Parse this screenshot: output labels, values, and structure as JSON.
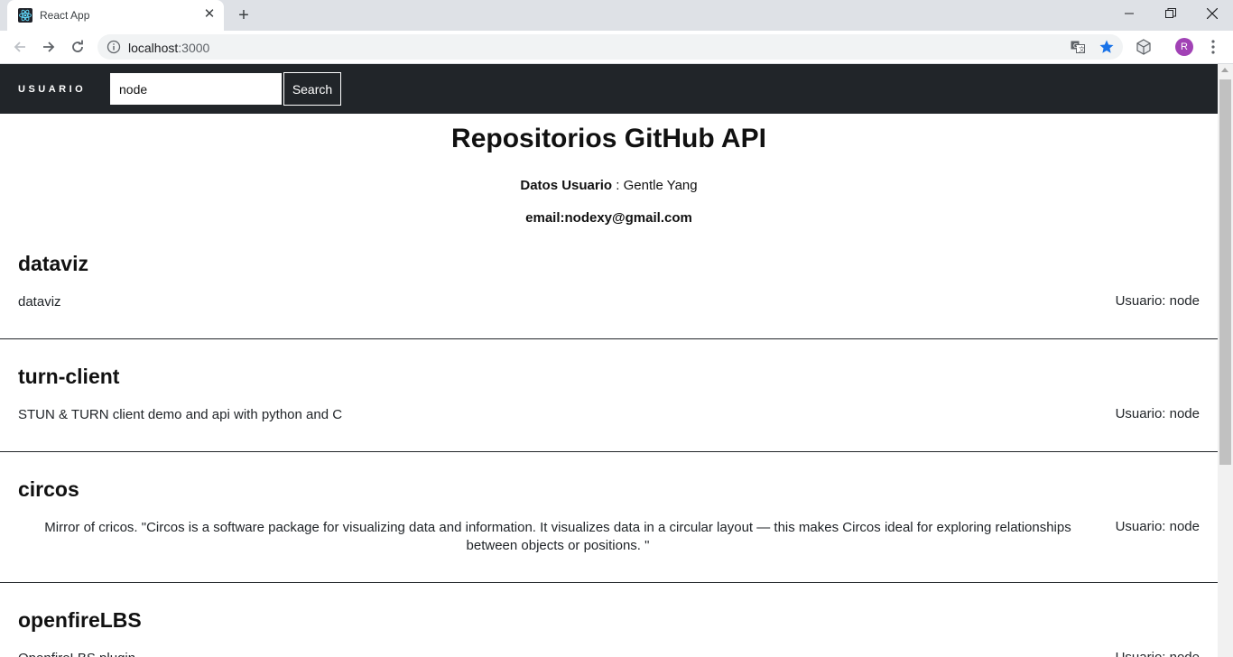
{
  "browser": {
    "tab_title": "React App",
    "url_host": "localhost",
    "url_port": ":3000"
  },
  "icons": {
    "favicon": "react-logo-icon",
    "close": "close-icon",
    "new_tab": "plus-icon",
    "back": "arrow-left-icon",
    "forward": "arrow-right-icon",
    "reload": "reload-icon",
    "info": "info-icon",
    "translate": "translate-icon",
    "bookmark": "star-icon",
    "extension": "cube-icon",
    "menu": "more-vert-icon"
  },
  "profile": {
    "initial": "R",
    "color": "#a142b5"
  },
  "app": {
    "brand": "USUARIO",
    "search_value": "node",
    "search_button": "Search",
    "title": "Repositorios GitHub API",
    "user_label": "Datos Usuario",
    "user_sep": " : ",
    "user_name": "Gentle Yang",
    "email": "email:nodexy@gmail.com"
  },
  "repos": [
    {
      "name": "dataviz",
      "description": "dataviz",
      "user": "Usuario: node"
    },
    {
      "name": "turn-client",
      "description": "STUN & TURN client demo and api with python and C",
      "user": "Usuario: node"
    },
    {
      "name": "circos",
      "description": "Mirror of cricos. \"Circos is a software package for visualizing data and information. It visualizes data in a circular layout — this makes Circos ideal for exploring relationships between objects or positions. \"",
      "user": "Usuario: node"
    },
    {
      "name": "openfireLBS",
      "description": "OpenfireLBS plugin",
      "user": "Usuario: node"
    }
  ],
  "colors": {
    "navbar": "#212529",
    "chrome_tabbar": "#dee1e6",
    "accent_star": "#1a73e8"
  }
}
